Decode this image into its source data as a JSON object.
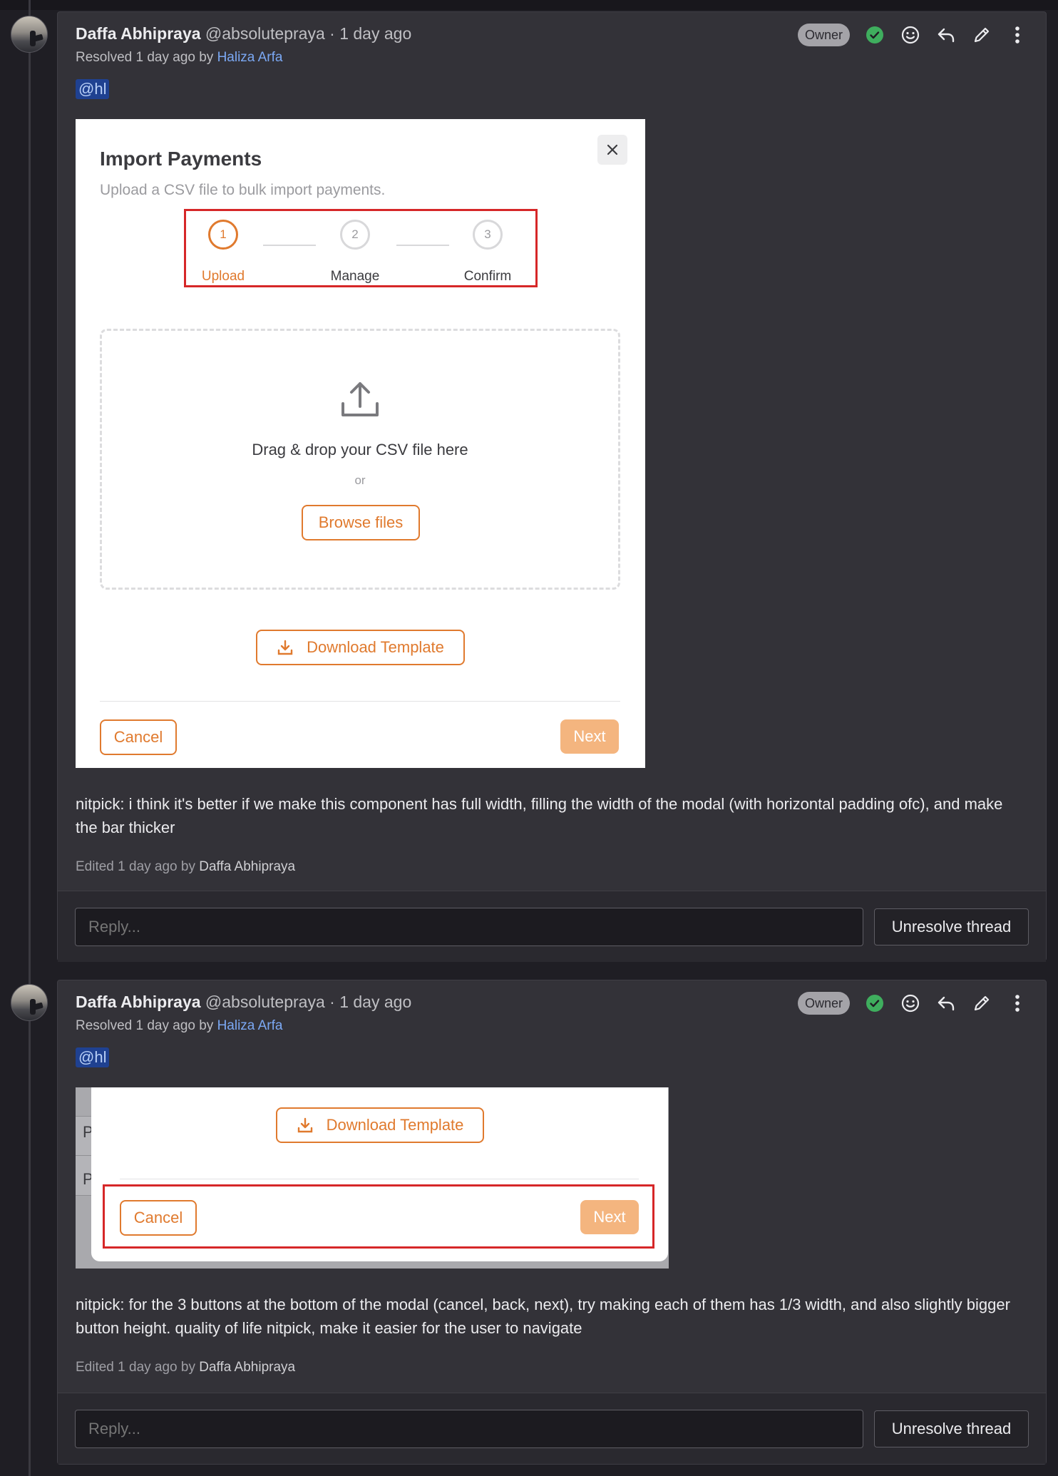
{
  "notes": [
    {
      "author_name": "Daffa Abhipraya",
      "author_handle": "@absolutepraya",
      "time": "· 1 day ago",
      "resolved_prefix": "Resolved 1 day ago by",
      "resolved_by": "Haliza Arfa",
      "role_badge": "Owner",
      "mention": "@hl",
      "screenshot": {
        "title": "Import Payments",
        "subtitle": "Upload a CSV file to bulk import payments.",
        "steps": [
          {
            "num": "1",
            "label": "Upload"
          },
          {
            "num": "2",
            "label": "Manage"
          },
          {
            "num": "3",
            "label": "Confirm"
          }
        ],
        "drop_text": "Drag & drop your CSV file here",
        "or_text": "or",
        "browse_label": "Browse files",
        "download_label": "Download Template",
        "cancel_label": "Cancel",
        "next_label": "Next"
      },
      "text": "nitpick: i think it's better if we make this component has full width, filling the width of the modal (with horizontal padding ofc), and make the bar thicker",
      "edited_prefix": "Edited 1 day ago by",
      "edited_by": "Daffa Abhipraya",
      "reply_placeholder": "Reply...",
      "unresolve_label": "Unresolve thread"
    },
    {
      "author_name": "Daffa Abhipraya",
      "author_handle": "@absolutepraya",
      "time": "· 1 day ago",
      "resolved_prefix": "Resolved 1 day ago by",
      "resolved_by": "Haliza Arfa",
      "role_badge": "Owner",
      "mention": "@hl",
      "screenshot": {
        "bg_letters": [
          "P",
          "P"
        ],
        "download_label": "Download Template",
        "cancel_label": "Cancel",
        "next_label": "Next"
      },
      "text": "nitpick: for the 3 buttons at the bottom of the modal (cancel, back, next), try making each of them has 1/3 width, and also slightly bigger button height. quality of life nitpick, make it easier for the user to navigate",
      "edited_prefix": "Edited 1 day ago by",
      "edited_by": "Daffa Abhipraya",
      "reply_placeholder": "Reply...",
      "unresolve_label": "Unresolve thread"
    }
  ],
  "colors": {
    "accent": "#e07a2e",
    "accent_disabled": "#f4b57f",
    "highlight_box": "#d62728",
    "link": "#7ba8f3",
    "resolved_check": "#3fae5e"
  },
  "icons": [
    "check-circle-icon",
    "smiley-icon",
    "reply-icon",
    "pencil-icon",
    "more-vertical-icon",
    "close-icon",
    "upload-icon",
    "download-icon"
  ]
}
